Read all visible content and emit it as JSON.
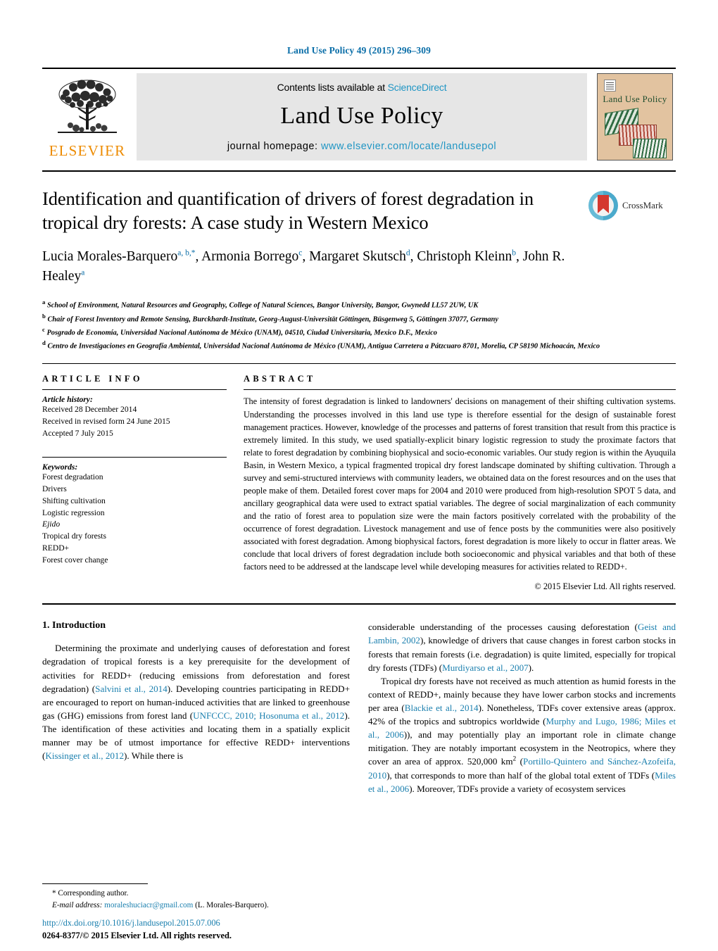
{
  "running_head": "Land Use Policy 49 (2015) 296–309",
  "masthead": {
    "publisher_name": "ELSEVIER",
    "contents_prefix": "Contents lists available at ",
    "contents_link": "ScienceDirect",
    "journal_name": "Land Use Policy",
    "homepage_prefix": "journal homepage: ",
    "homepage_url": "www.elsevier.com/locate/landusepol",
    "cover_title": "Land Use Policy"
  },
  "article": {
    "title": "Identification and quantification of drivers of forest degradation in tropical dry forests: A case study in Western Mexico",
    "authors_line_1": "Lucia Morales-Barquero",
    "authors_line_1_sup": "a, b,*",
    "authors_2": "Armonia Borrego",
    "authors_2_sup": "c",
    "authors_3": "Margaret Skutsch",
    "authors_3_sup": "d",
    "authors_4": "Christoph Kleinn",
    "authors_4_sup": "b",
    "authors_5": "John R. Healey",
    "authors_5_sup": "a",
    "crossmark_label": "CrossMark",
    "affiliations": [
      {
        "marker": "a",
        "text": "School of Environment, Natural Resources and Geography, College of Natural Sciences, Bangor University, Bangor, Gwynedd LL57 2UW, UK"
      },
      {
        "marker": "b",
        "text": "Chair of Forest Inventory and Remote Sensing, Burckhardt-Institute, Georg-August-Universität Göttingen, Büsgenweg 5, Göttingen 37077, Germany"
      },
      {
        "marker": "c",
        "text": "Posgrado de Economía, Universidad Nacional Autónoma de México (UNAM), 04510, Ciudad Universitaria, Mexico D.F., Mexico"
      },
      {
        "marker": "d",
        "text": "Centro de Investigaciones en Geografía Ambiental, Universidad Nacional Autónoma de México (UNAM), Antigua Carretera a Pátzcuaro 8701, Morelia, CP 58190 Michoacán, Mexico"
      }
    ]
  },
  "article_info": {
    "heading": "ARTICLE INFO",
    "history_label": "Article history:",
    "history": [
      "Received 28 December 2014",
      "Received in revised form 24 June 2015",
      "Accepted 7 July 2015"
    ],
    "keywords_label": "Keywords:",
    "keywords": [
      "Forest degradation",
      "Drivers",
      "Shifting cultivation",
      "Logistic regression",
      "Ejido",
      "Tropical dry forests",
      "REDD+",
      "Forest cover change"
    ],
    "keyword_italic_index": 4
  },
  "abstract": {
    "heading": "ABSTRACT",
    "text": "The intensity of forest degradation is linked to landowners' decisions on management of their shifting cultivation systems. Understanding the processes involved in this land use type is therefore essential for the design of sustainable forest management practices. However, knowledge of the processes and patterns of forest transition that result from this practice is extremely limited. In this study, we used spatially-explicit binary logistic regression to study the proximate factors that relate to forest degradation by combining biophysical and socio-economic variables. Our study region is within the Ayuquila Basin, in Western Mexico, a typical fragmented tropical dry forest landscape dominated by shifting cultivation. Through a survey and semi-structured interviews with community leaders, we obtained data on the forest resources and on the uses that people make of them. Detailed forest cover maps for 2004 and 2010 were produced from high-resolution SPOT 5 data, and ancillary geographical data were used to extract spatial variables. The degree of social marginalization of each community and the ratio of forest area to population size were the main factors positively correlated with the probability of the occurrence of forest degradation. Livestock management and use of fence posts by the communities were also positively associated with forest degradation. Among biophysical factors, forest degradation is more likely to occur in flatter areas. We conclude that local drivers of forest degradation include both socioeconomic and physical variables and that both of these factors need to be addressed at the landscape level while developing measures for activities related to REDD+.",
    "copyright": "© 2015 Elsevier Ltd. All rights reserved."
  },
  "body": {
    "section_number_title": "1.  Introduction",
    "left_paragraph_1": {
      "p1_a": "Determining the proximate and underlying causes of deforestation and forest degradation of tropical forests is a key prerequisite for the development of activities for REDD+ (reducing emissions from deforestation and forest degradation) (",
      "p1_ref1": "Salvini et al., 2014",
      "p1_b": "). Developing countries participating in REDD+ are encouraged to report on human-induced activities that are linked to greenhouse gas (GHG) emissions from forest land (",
      "p1_ref2": "UNFCCC, 2010; Hosonuma et al., 2012",
      "p1_c": "). The identification of these activities and locating them in a spatially explicit manner may be of utmost importance for effective REDD+ interventions (",
      "p1_ref3": "Kissinger et al., 2012",
      "p1_d": "). While there is"
    },
    "right_paragraph_1": {
      "a": "considerable understanding of the processes causing deforestation (",
      "ref1": "Geist and Lambin, 2002",
      "b": "), knowledge of drivers that cause changes in forest carbon stocks in forests that remain forests (i.e. degradation) is quite limited, especially for tropical dry forests (TDFs) (",
      "ref2": "Murdiyarso et al., 2007",
      "c": ")."
    },
    "right_paragraph_2": {
      "a": "Tropical dry forests have not received as much attention as humid forests in the context of REDD+, mainly because they have lower carbon stocks and increments per area (",
      "ref1": "Blackie et al., 2014",
      "b": "). Nonetheless, TDFs cover extensive areas (approx. 42% of the tropics and subtropics worldwide (",
      "ref2": "Murphy and Lugo, 1986; Miles et al., 2006",
      "c": ")), and may potentially play an important role in climate change mitigation. They are notably important ecosystem in the Neotropics, where they cover an area of approx. 520,000 km",
      "sup": "2",
      "d": " (",
      "ref3": "Portillo-Quintero and Sánchez-Azofeifa, 2010",
      "e": "), that corresponds to more than half of the global total extent of TDFs (",
      "ref4": "Miles et al., 2006",
      "f": "). Moreover, TDFs provide a variety of ecosystem services"
    }
  },
  "footer": {
    "corresponding_marker": "*",
    "corresponding_label": "Corresponding author.",
    "email_label": "E-mail address:",
    "email": "moraleshuciacr@gmail.com",
    "email_owner": "(L. Morales-Barquero).",
    "doi_url": "http://dx.doi.org/10.1016/j.landusepol.2015.07.006",
    "issn_line": "0264-8377/© 2015 Elsevier Ltd. All rights reserved."
  },
  "colors": {
    "link_blue": "#1a7fae",
    "elsevier_orange": "#ED8B00",
    "masthead_gray": "#e6e6e6",
    "cover_tan": "#e2c3a0"
  }
}
